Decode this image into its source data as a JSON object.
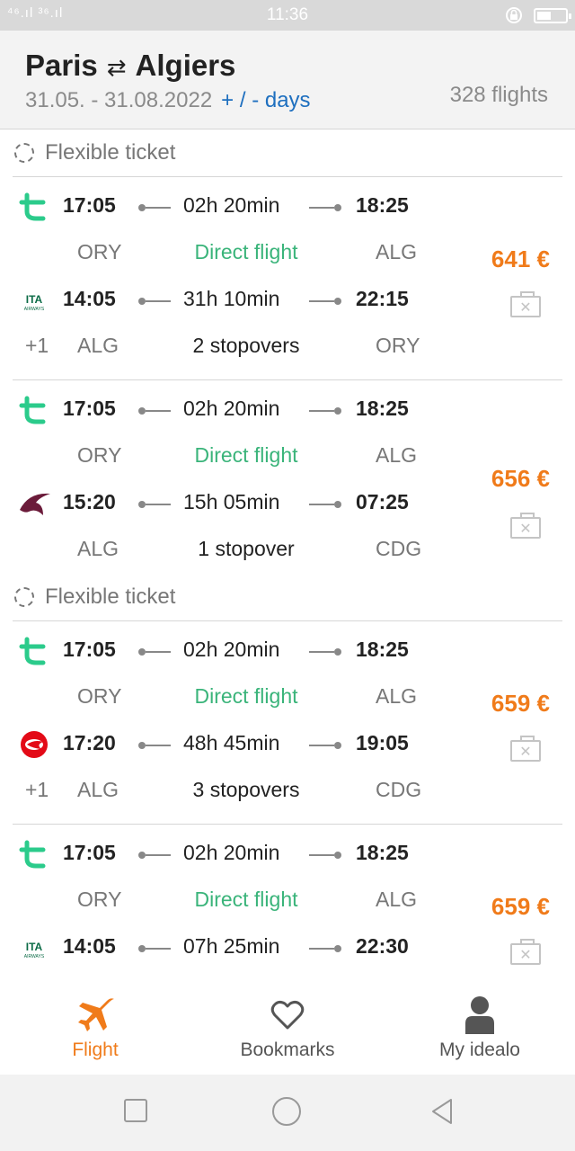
{
  "status": {
    "signal": "⁴⁶.ıl ³⁶.ıl",
    "time": "11:36"
  },
  "header": {
    "origin": "Paris",
    "swap_symbol": "⇄",
    "destination": "Algiers",
    "dates": "31.05. - 31.08.2022",
    "days_link": "+ / - days",
    "count": "328 flights"
  },
  "colors": {
    "accent": "#f07b1a",
    "direct": "#3ab47a",
    "link": "#1e6fbf"
  },
  "bookmark_icon_glyph": "✕",
  "list": {
    "flex1": "Flexible ticket",
    "flex2": "Flexible ticket",
    "cards": [
      {
        "price": "641 €",
        "outbound": {
          "airline": "transavia",
          "dep": "17:05",
          "dur": "02h 20min",
          "arr": "18:25",
          "from": "ORY",
          "stops": "Direct flight",
          "to": "ALG"
        },
        "return": {
          "airline": "ITA Airways",
          "plus": "",
          "dep": "14:05",
          "dur": "31h 10min",
          "arr": "22:15",
          "plus2": "+1",
          "from": "ALG",
          "stops": "2 stopovers",
          "to": "ORY"
        }
      },
      {
        "price": "656 €",
        "outbound": {
          "airline": "transavia",
          "dep": "17:05",
          "dur": "02h 20min",
          "arr": "18:25",
          "from": "ORY",
          "stops": "Direct flight",
          "to": "ALG"
        },
        "return": {
          "airline": "Qatar Airways",
          "dep": "15:20",
          "dur": "15h 05min",
          "arr": "07:25",
          "plus2": "",
          "from": "ALG",
          "stops": "1 stopover",
          "to": "CDG"
        }
      },
      {
        "price": "659 €",
        "outbound": {
          "airline": "transavia",
          "dep": "17:05",
          "dur": "02h 20min",
          "arr": "18:25",
          "from": "ORY",
          "stops": "Direct flight",
          "to": "ALG"
        },
        "return": {
          "airline": "Turkish Airlines",
          "dep": "17:20",
          "dur": "48h 45min",
          "arr": "19:05",
          "plus2": "+1",
          "from": "ALG",
          "stops": "3 stopovers",
          "to": "CDG"
        }
      },
      {
        "price": "659 €",
        "outbound": {
          "airline": "transavia",
          "dep": "17:05",
          "dur": "02h 20min",
          "arr": "18:25",
          "from": "ORY",
          "stops": "Direct flight",
          "to": "ALG"
        },
        "return": {
          "airline": "ITA Airways",
          "dep": "14:05",
          "dur": "07h 25min",
          "arr": "22:30"
        }
      }
    ]
  },
  "nav": {
    "flight": "Flight",
    "bookmarks": "Bookmarks",
    "account": "My idealo"
  }
}
